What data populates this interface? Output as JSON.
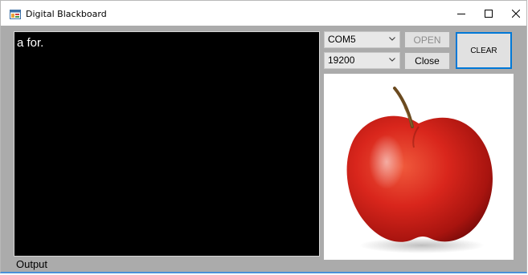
{
  "window": {
    "title": "Digital Blackboard"
  },
  "canvas": {
    "text": "a for."
  },
  "output": {
    "label": "Output"
  },
  "port": {
    "selected": "COM5"
  },
  "baud": {
    "selected": "19200"
  },
  "buttons": {
    "open": "OPEN",
    "close": "Close",
    "clear": "CLEAR"
  },
  "colors": {
    "canvas_bg": "#000000",
    "form_bg": "#ababab",
    "accent": "#0078d7"
  },
  "icons": {
    "app": "app-window-icon",
    "minimize": "minimize-icon",
    "maximize": "maximize-icon",
    "close": "close-icon",
    "dropdown": "chevron-down-icon"
  },
  "picture": {
    "subject": "apple-image"
  }
}
